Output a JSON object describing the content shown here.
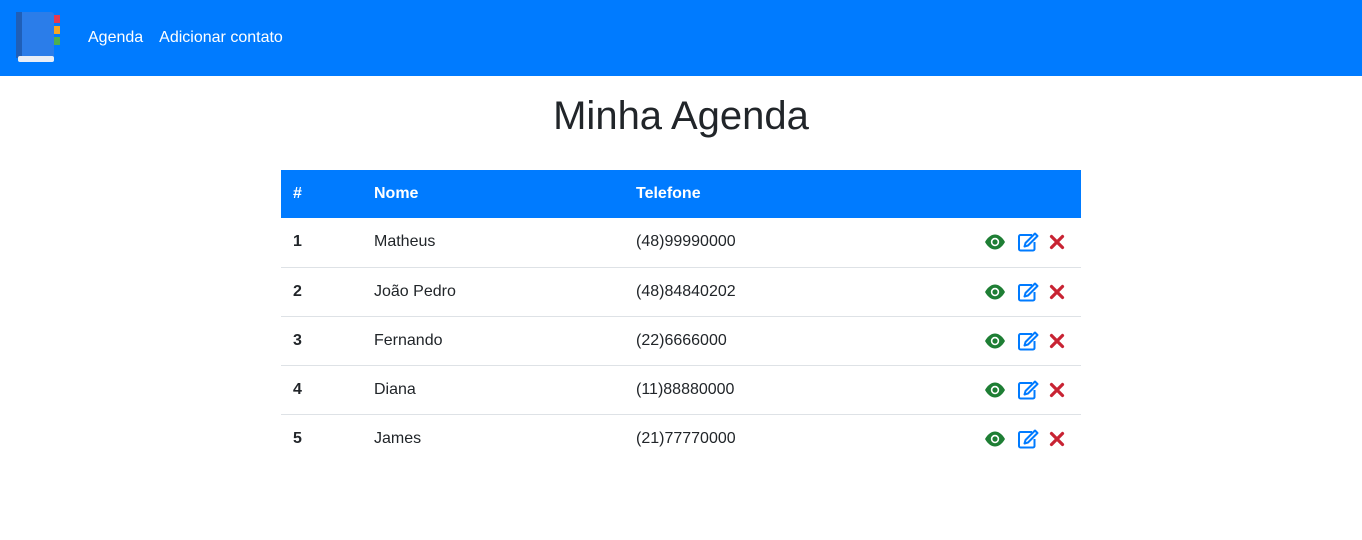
{
  "nav": {
    "brand_icon": "address-book-icon",
    "links": [
      "Agenda",
      "Adicionar contato"
    ]
  },
  "page": {
    "title": "Minha Agenda"
  },
  "table": {
    "headers": [
      "#",
      "Nome",
      "Telefone",
      ""
    ],
    "rows": [
      {
        "id": "1",
        "nome": "Matheus",
        "telefone": "(48)99990000"
      },
      {
        "id": "2",
        "nome": "João Pedro",
        "telefone": "(48)84840202"
      },
      {
        "id": "3",
        "nome": "Fernando",
        "telefone": "(22)6666000"
      },
      {
        "id": "4",
        "nome": "Diana",
        "telefone": "(11)88880000"
      },
      {
        "id": "5",
        "nome": "James",
        "telefone": "(21)77770000"
      }
    ],
    "action_icons": [
      "eye-icon",
      "edit-icon",
      "close-icon"
    ]
  },
  "colors": {
    "primary": "#007bff",
    "view": "#1e7e34",
    "edit": "#007bff",
    "delete": "#c82333"
  }
}
